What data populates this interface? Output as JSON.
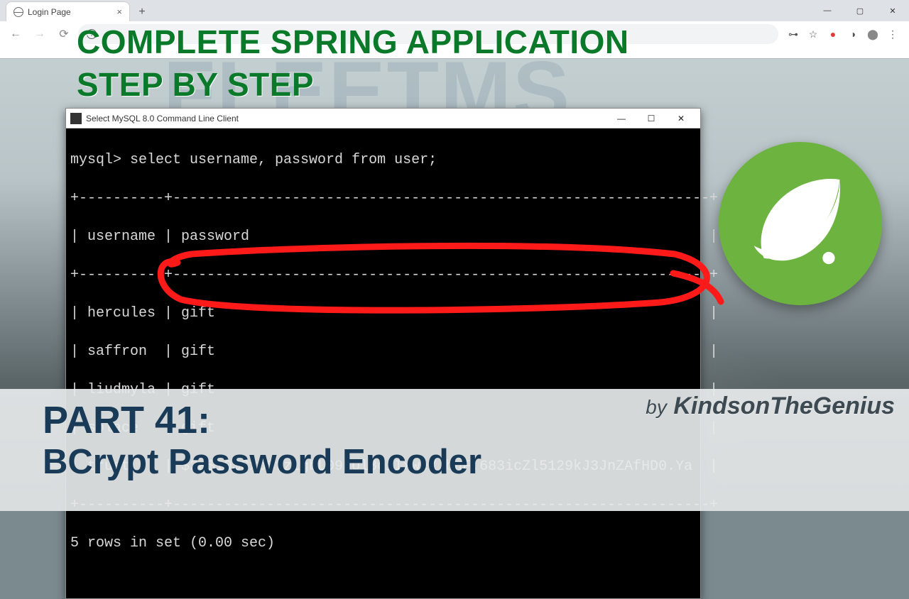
{
  "browser": {
    "tab_title": "Login Page",
    "url_placeholder": "",
    "win": {
      "min": "—",
      "max": "▢",
      "close": "✕"
    }
  },
  "watermark": "FLEETMS",
  "overlay": {
    "line1": "COMPLETE SPRING APPLICATION",
    "line2": "STEP BY STEP"
  },
  "terminal": {
    "title": "Select MySQL 8.0 Command Line Client",
    "win": {
      "min": "—",
      "max": "☐",
      "close": "✕"
    },
    "prompt": "mysql> select username, password from user;",
    "sep_top": "+----------+---------------------------------------------------------------+",
    "headers": "| username | password                                                      |",
    "sep_mid": "+----------+---------------------------------------------------------------+",
    "rows": [
      "| hercules | gift                                                          |",
      "| saffron  | gift                                                          |",
      "| liudmyla | gift                                                          |",
      "| solace   | gift                                                          |",
      "| trust    | $2a$10$SxbSfzLgbL09hUl8ciIxweZ.bnF.683icZl5129kJ3JnZAfHD0.Ya  |"
    ],
    "sep_bot": "+----------+---------------------------------------------------------------+",
    "footer": "5 rows in set (0.00 sec)"
  },
  "bottom": {
    "part": "PART 41:",
    "subtitle": "BCrypt Password Encoder"
  },
  "byline": {
    "by": "by",
    "name": "KindsonTheGenius"
  },
  "icons": {
    "back": "←",
    "fwd": "→",
    "reload": "⟳",
    "info": "i",
    "key": "⊶",
    "star": "☆",
    "dot": "●",
    "puzzle": "◑",
    "avatar": "⬤",
    "more": "⋮",
    "plus": "+"
  }
}
